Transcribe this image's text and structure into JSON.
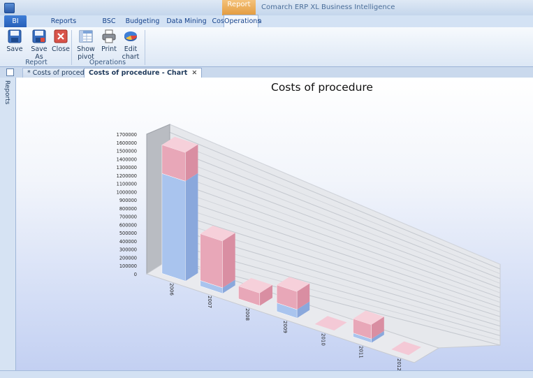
{
  "window": {
    "context_tab": "Report",
    "title": "Comarch ERP XL Business Intelligence"
  },
  "ribbon_tabs": [
    {
      "label": "BI",
      "state": "file"
    },
    {
      "label": "Reports management",
      "state": "normal"
    },
    {
      "label": "BSC",
      "state": "normal"
    },
    {
      "label": "Budgeting",
      "state": "normal"
    },
    {
      "label": "Data Mining",
      "state": "normal"
    },
    {
      "label": "Cost Allocation",
      "state": "normal"
    },
    {
      "label": "Operations",
      "state": "active"
    }
  ],
  "ribbon": {
    "report_group": "Report",
    "operations_group": "Operations",
    "save": "Save",
    "save_as": "Save As",
    "close": "Close",
    "show_pivot": "Show pivot",
    "print": "Print",
    "edit_chart": "Edit chart"
  },
  "document_tabs": [
    {
      "label": "* Costs of procedure",
      "active": false
    },
    {
      "label": "Costs of procedure - Chart",
      "active": true
    }
  ],
  "sidebar": {
    "label": "Reports"
  },
  "colors": {
    "series_top": "#e8a7b8",
    "series_bottom": "#a9c4ee",
    "ribbon_accent": "#2860b9"
  },
  "chart_data": {
    "type": "bar",
    "title": "Costs of procedure",
    "categories": [
      "2006",
      "2007",
      "2008",
      "2009",
      "2010",
      "2011",
      "2012"
    ],
    "series": [
      {
        "values": [
          1220000,
          70000,
          0,
          110000,
          0,
          50000,
          0
        ]
      },
      {
        "values": [
          350000,
          580000,
          160000,
          230000,
          0,
          190000,
          0
        ]
      }
    ],
    "yticks": [
      0,
      100000,
      200000,
      300000,
      400000,
      500000,
      600000,
      700000,
      800000,
      900000,
      1000000,
      1100000,
      1200000,
      1300000,
      1400000,
      1500000,
      1600000,
      1700000
    ],
    "ylim": [
      0,
      1700000
    ],
    "grid": true,
    "legend": "none",
    "three_d": true
  }
}
